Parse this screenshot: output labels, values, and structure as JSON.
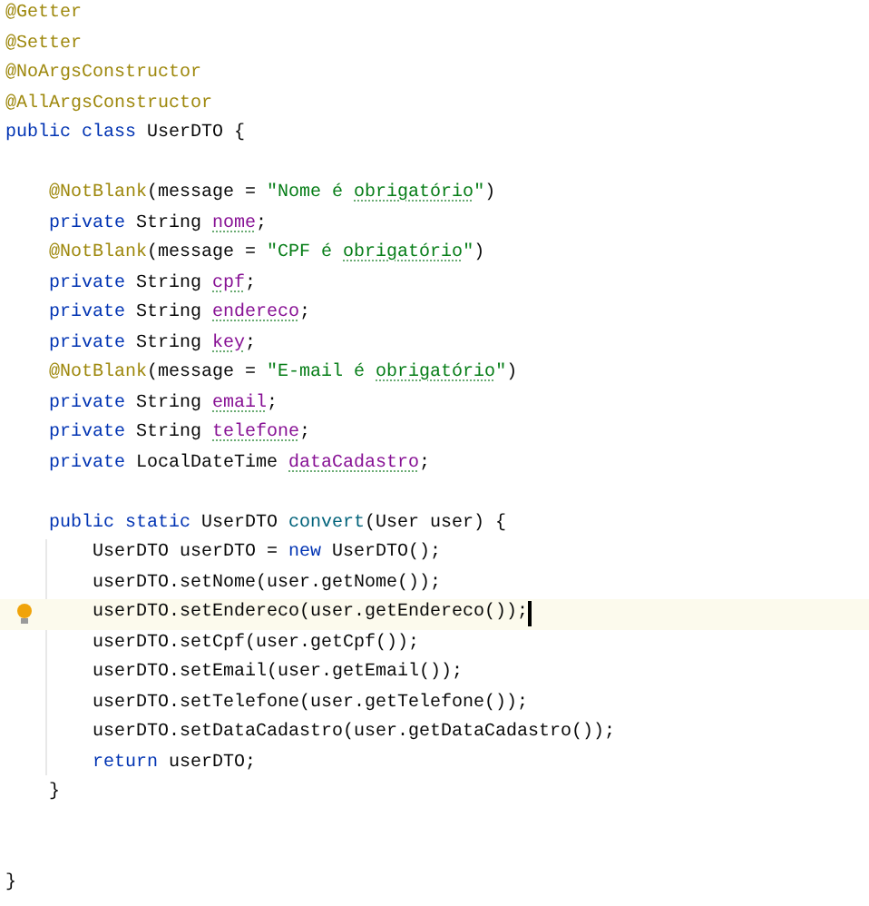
{
  "editor": {
    "lines": [
      {
        "current": false,
        "tokens": [
          {
            "kind": "annotation",
            "text": "@Getter"
          }
        ]
      },
      {
        "current": false,
        "tokens": [
          {
            "kind": "annotation",
            "text": "@Setter"
          }
        ]
      },
      {
        "current": false,
        "tokens": [
          {
            "kind": "annotation",
            "text": "@NoArgsConstructor"
          }
        ]
      },
      {
        "current": false,
        "tokens": [
          {
            "kind": "annotation",
            "text": "@AllArgsConstructor"
          }
        ]
      },
      {
        "current": false,
        "tokens": [
          {
            "kind": "keyword",
            "text": "public class "
          },
          {
            "kind": "plain",
            "text": "UserDTO {"
          }
        ],
        "children": [
          {
            "current": false
          },
          {
            "current": false,
            "tokens": [
              {
                "kind": "annotation",
                "text": "@NotBlank"
              },
              {
                "kind": "plain",
                "text": "(message = "
              },
              {
                "kind": "string",
                "text": "\"Nome é "
              },
              {
                "kind": "string",
                "text": "obrigatório",
                "typo": true
              },
              {
                "kind": "string",
                "text": "\""
              },
              {
                "kind": "plain",
                "text": ")"
              }
            ]
          },
          {
            "current": false,
            "tokens": [
              {
                "kind": "keyword",
                "text": "private "
              },
              {
                "kind": "plain",
                "text": "String "
              },
              {
                "kind": "field",
                "text": "nome",
                "typo": true
              },
              {
                "kind": "plain",
                "text": ";"
              }
            ]
          },
          {
            "current": false,
            "tokens": [
              {
                "kind": "annotation",
                "text": "@NotBlank"
              },
              {
                "kind": "plain",
                "text": "(message = "
              },
              {
                "kind": "string",
                "text": "\"CPF é "
              },
              {
                "kind": "string",
                "text": "obrigatório",
                "typo": true
              },
              {
                "kind": "string",
                "text": "\""
              },
              {
                "kind": "plain",
                "text": ")"
              }
            ]
          },
          {
            "current": false,
            "tokens": [
              {
                "kind": "keyword",
                "text": "private "
              },
              {
                "kind": "plain",
                "text": "String "
              },
              {
                "kind": "field",
                "text": "cpf",
                "typo": true
              },
              {
                "kind": "plain",
                "text": ";"
              }
            ]
          },
          {
            "current": false,
            "tokens": [
              {
                "kind": "keyword",
                "text": "private "
              },
              {
                "kind": "plain",
                "text": "String "
              },
              {
                "kind": "field",
                "text": "endereco",
                "typo": true
              },
              {
                "kind": "plain",
                "text": ";"
              }
            ]
          },
          {
            "current": false,
            "tokens": [
              {
                "kind": "keyword",
                "text": "private "
              },
              {
                "kind": "plain",
                "text": "String "
              },
              {
                "kind": "field",
                "text": "key",
                "typo": true
              },
              {
                "kind": "plain",
                "text": ";"
              }
            ]
          },
          {
            "current": false,
            "tokens": [
              {
                "kind": "annotation",
                "text": "@NotBlank"
              },
              {
                "kind": "plain",
                "text": "(message = "
              },
              {
                "kind": "string",
                "text": "\"E-mail é "
              },
              {
                "kind": "string",
                "text": "obrigatório",
                "typo": true
              },
              {
                "kind": "string",
                "text": "\""
              },
              {
                "kind": "plain",
                "text": ")"
              }
            ]
          },
          {
            "current": false,
            "tokens": [
              {
                "kind": "keyword",
                "text": "private "
              },
              {
                "kind": "plain",
                "text": "String "
              },
              {
                "kind": "field",
                "text": "email",
                "typo": true
              },
              {
                "kind": "plain",
                "text": ";"
              }
            ]
          },
          {
            "current": false,
            "tokens": [
              {
                "kind": "keyword",
                "text": "private "
              },
              {
                "kind": "plain",
                "text": "String "
              },
              {
                "kind": "field",
                "text": "telefone",
                "typo": true
              },
              {
                "kind": "plain",
                "text": ";"
              }
            ]
          },
          {
            "current": false,
            "tokens": [
              {
                "kind": "keyword",
                "text": "private "
              },
              {
                "kind": "plain",
                "text": "LocalDateTime "
              },
              {
                "kind": "field",
                "text": "dataCadastro",
                "typo": true
              },
              {
                "kind": "plain",
                "text": ";"
              }
            ]
          },
          {
            "current": false
          },
          {
            "current": false,
            "tokens": [
              {
                "kind": "keyword",
                "text": "public static "
              },
              {
                "kind": "plain",
                "text": "UserDTO "
              },
              {
                "kind": "method",
                "text": "convert"
              },
              {
                "kind": "plain",
                "text": "(User user) {"
              }
            ],
            "children": [
              {
                "current": false,
                "tokens": [
                  {
                    "kind": "plain",
                    "text": "UserDTO userDTO = "
                  },
                  {
                    "kind": "keyword",
                    "text": "new "
                  },
                  {
                    "kind": "plain",
                    "text": "UserDTO();"
                  }
                ]
              },
              {
                "current": false,
                "tokens": [
                  {
                    "kind": "plain",
                    "text": "userDTO.setNome(user.getNome());"
                  }
                ]
              },
              {
                "current": true,
                "tokens": [
                  {
                    "kind": "plain",
                    "text": "userDTO.setEndereco(user.getEndereco());"
                  }
                ]
              },
              {
                "current": false,
                "tokens": [
                  {
                    "kind": "plain",
                    "text": "userDTO.setCpf(user.getCpf());"
                  }
                ]
              },
              {
                "current": false,
                "tokens": [
                  {
                    "kind": "plain",
                    "text": "userDTO.setEmail(user.getEmail());"
                  }
                ]
              },
              {
                "current": false,
                "tokens": [
                  {
                    "kind": "plain",
                    "text": "userDTO.setTelefone(user.getTelefone());"
                  }
                ]
              },
              {
                "current": false,
                "tokens": [
                  {
                    "kind": "plain",
                    "text": "userDTO.setDataCadastro(user.getDataCadastro());"
                  }
                ]
              },
              {
                "current": false,
                "tokens": [
                  {
                    "kind": "keyword",
                    "text": "return "
                  },
                  {
                    "kind": "plain",
                    "text": "userDTO;"
                  }
                ]
              }
            ]
          },
          {
            "current": false,
            "tokens": [
              {
                "kind": "plain",
                "text": "}"
              }
            ]
          },
          {
            "current": false
          },
          {
            "current": false
          }
        ]
      },
      {
        "current": false,
        "tokens": [
          {
            "kind": "plain",
            "text": "}"
          }
        ]
      }
    ]
  }
}
